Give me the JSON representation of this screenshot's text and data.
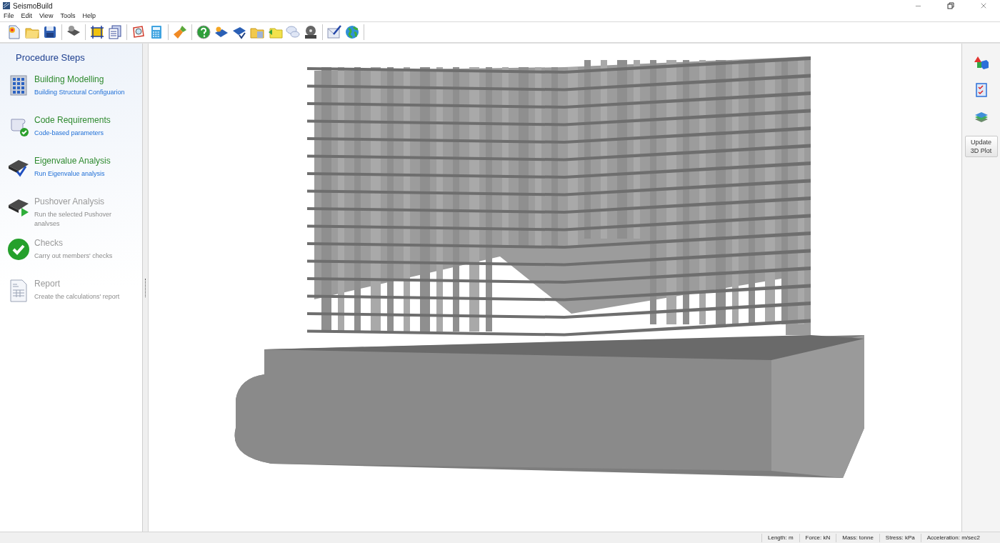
{
  "window": {
    "title": "SeismoBuild"
  },
  "menu": [
    "File",
    "Edit",
    "View",
    "Tools",
    "Help"
  ],
  "procedure": {
    "title": "Procedure Steps",
    "steps": [
      {
        "kind": "building",
        "title": "Building Modelling",
        "subtitle": "Building Structural Configuarion",
        "disabled": false
      },
      {
        "kind": "code",
        "title": "Code Requirements",
        "subtitle": "Code-based parameters",
        "disabled": false
      },
      {
        "kind": "eigen",
        "title": "Eigenvalue Analysis",
        "subtitle": "Run Eigenvalue analysis",
        "disabled": false
      },
      {
        "kind": "pushover",
        "title": "Pushover Analysis",
        "subtitle": "Run the selected Pushover analvses",
        "disabled": true
      },
      {
        "kind": "checks",
        "title": "Checks",
        "subtitle": "Carry out members' checks",
        "disabled": true
      },
      {
        "kind": "report",
        "title": "Report",
        "subtitle": "Create the calculations' report",
        "disabled": true
      }
    ]
  },
  "side_panel": {
    "update_button": "Update 3D Plot"
  },
  "status_bar": [
    "Length: m",
    "Force: kN",
    "Mass: tonne",
    "Stress: kPa",
    "Acceleration: m/sec2"
  ]
}
